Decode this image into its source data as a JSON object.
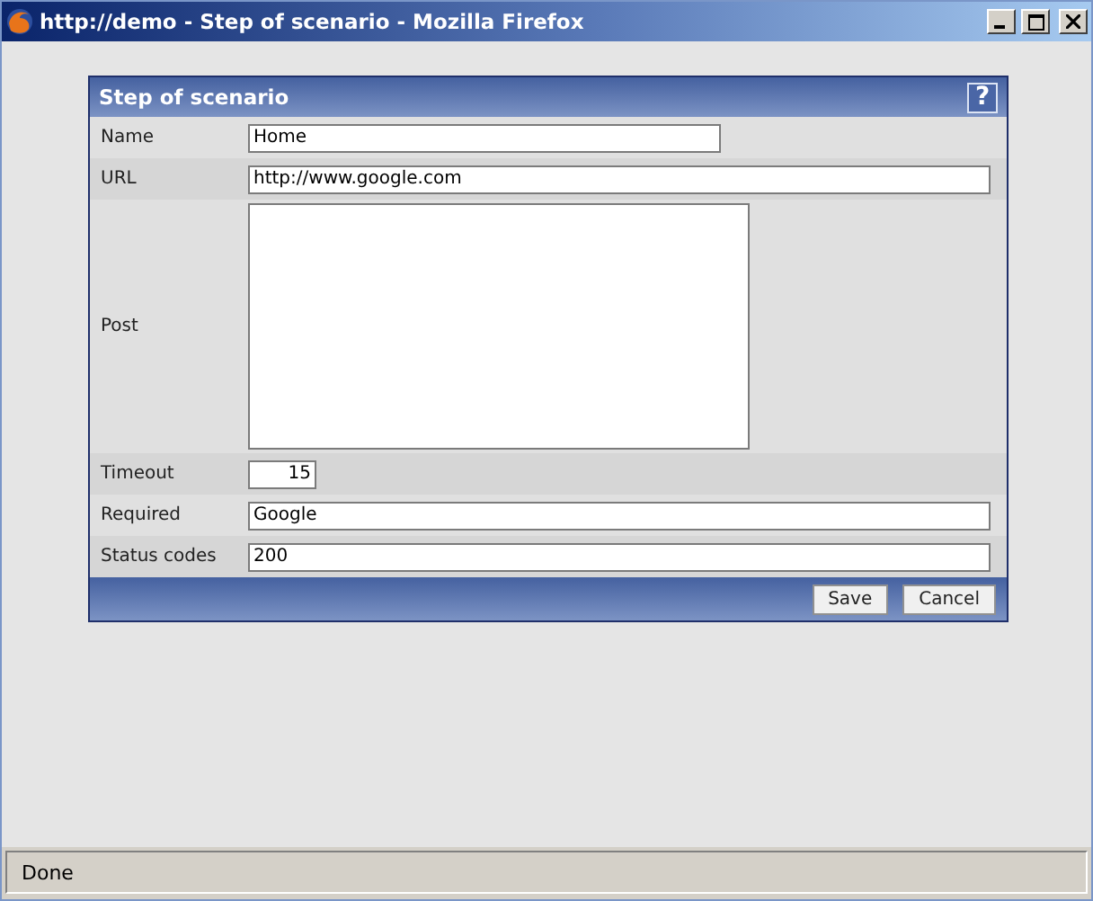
{
  "window": {
    "title": "http://demo - Step of scenario - Mozilla Firefox"
  },
  "dialog": {
    "title": "Step of scenario",
    "help": "?",
    "fields": [
      {
        "label": "Name",
        "kind": "short",
        "value": "Home"
      },
      {
        "label": "URL",
        "kind": "long",
        "value": "http://www.google.com"
      },
      {
        "label": "Post",
        "kind": "area"
      },
      {
        "label": "Timeout",
        "kind": "number",
        "value": "15"
      },
      {
        "label": "Required",
        "kind": "long",
        "value": "Google"
      },
      {
        "label": "Status codes",
        "kind": "long",
        "value": "200"
      }
    ],
    "buttons": [
      "Save",
      "Cancel"
    ]
  },
  "status_bar": "Done"
}
